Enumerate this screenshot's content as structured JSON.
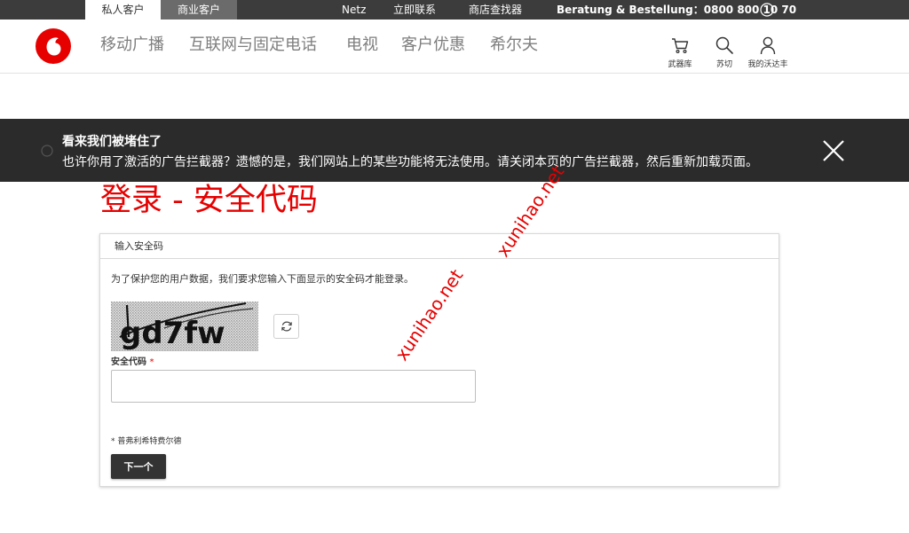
{
  "topbar": {
    "segments": [
      "私人客户",
      "商业客户"
    ],
    "links": [
      "Netz",
      "立即联系",
      "商店查找器"
    ],
    "hotline": "Beratung & Bestellung：0800 800 10 70"
  },
  "nav": {
    "items": [
      "移动广播",
      "互联网与固定电话",
      "电视",
      "客户优惠",
      "希尔夫"
    ],
    "tools": {
      "cart": "武器库",
      "search": "苏切",
      "account": "我的沃达丰"
    }
  },
  "ad_banner": {
    "title": "看来我们被堵住了",
    "text": "也许你用了激活的广告拦截器？遗憾的是，我们网站上的某些功能将无法使用。请关闭本页的广告拦截器，然后重新加载页面。"
  },
  "page": {
    "title": "登录 - 安全代码"
  },
  "form": {
    "card_title": "输入安全码",
    "description": "为了保护您的用户数据，我们要求您输入下面显示的安全码才能登录。",
    "captcha_text": "gd7fw",
    "field_label": "安全代码",
    "required_mark": "*",
    "input_value": "",
    "footnote": "* 普弗利希特费尔德",
    "next_label": "下一个"
  },
  "watermarks": [
    "xunihao.net",
    "xunihao.net"
  ],
  "colors": {
    "brand_red": "#e60000",
    "topbar": "#3c3c3c",
    "banner": "#2b2b2b",
    "button": "#333333"
  },
  "icons": [
    "info-icon",
    "vodafone-logo",
    "cart-icon",
    "search-icon",
    "user-icon",
    "close-icon",
    "refresh-icon"
  ]
}
